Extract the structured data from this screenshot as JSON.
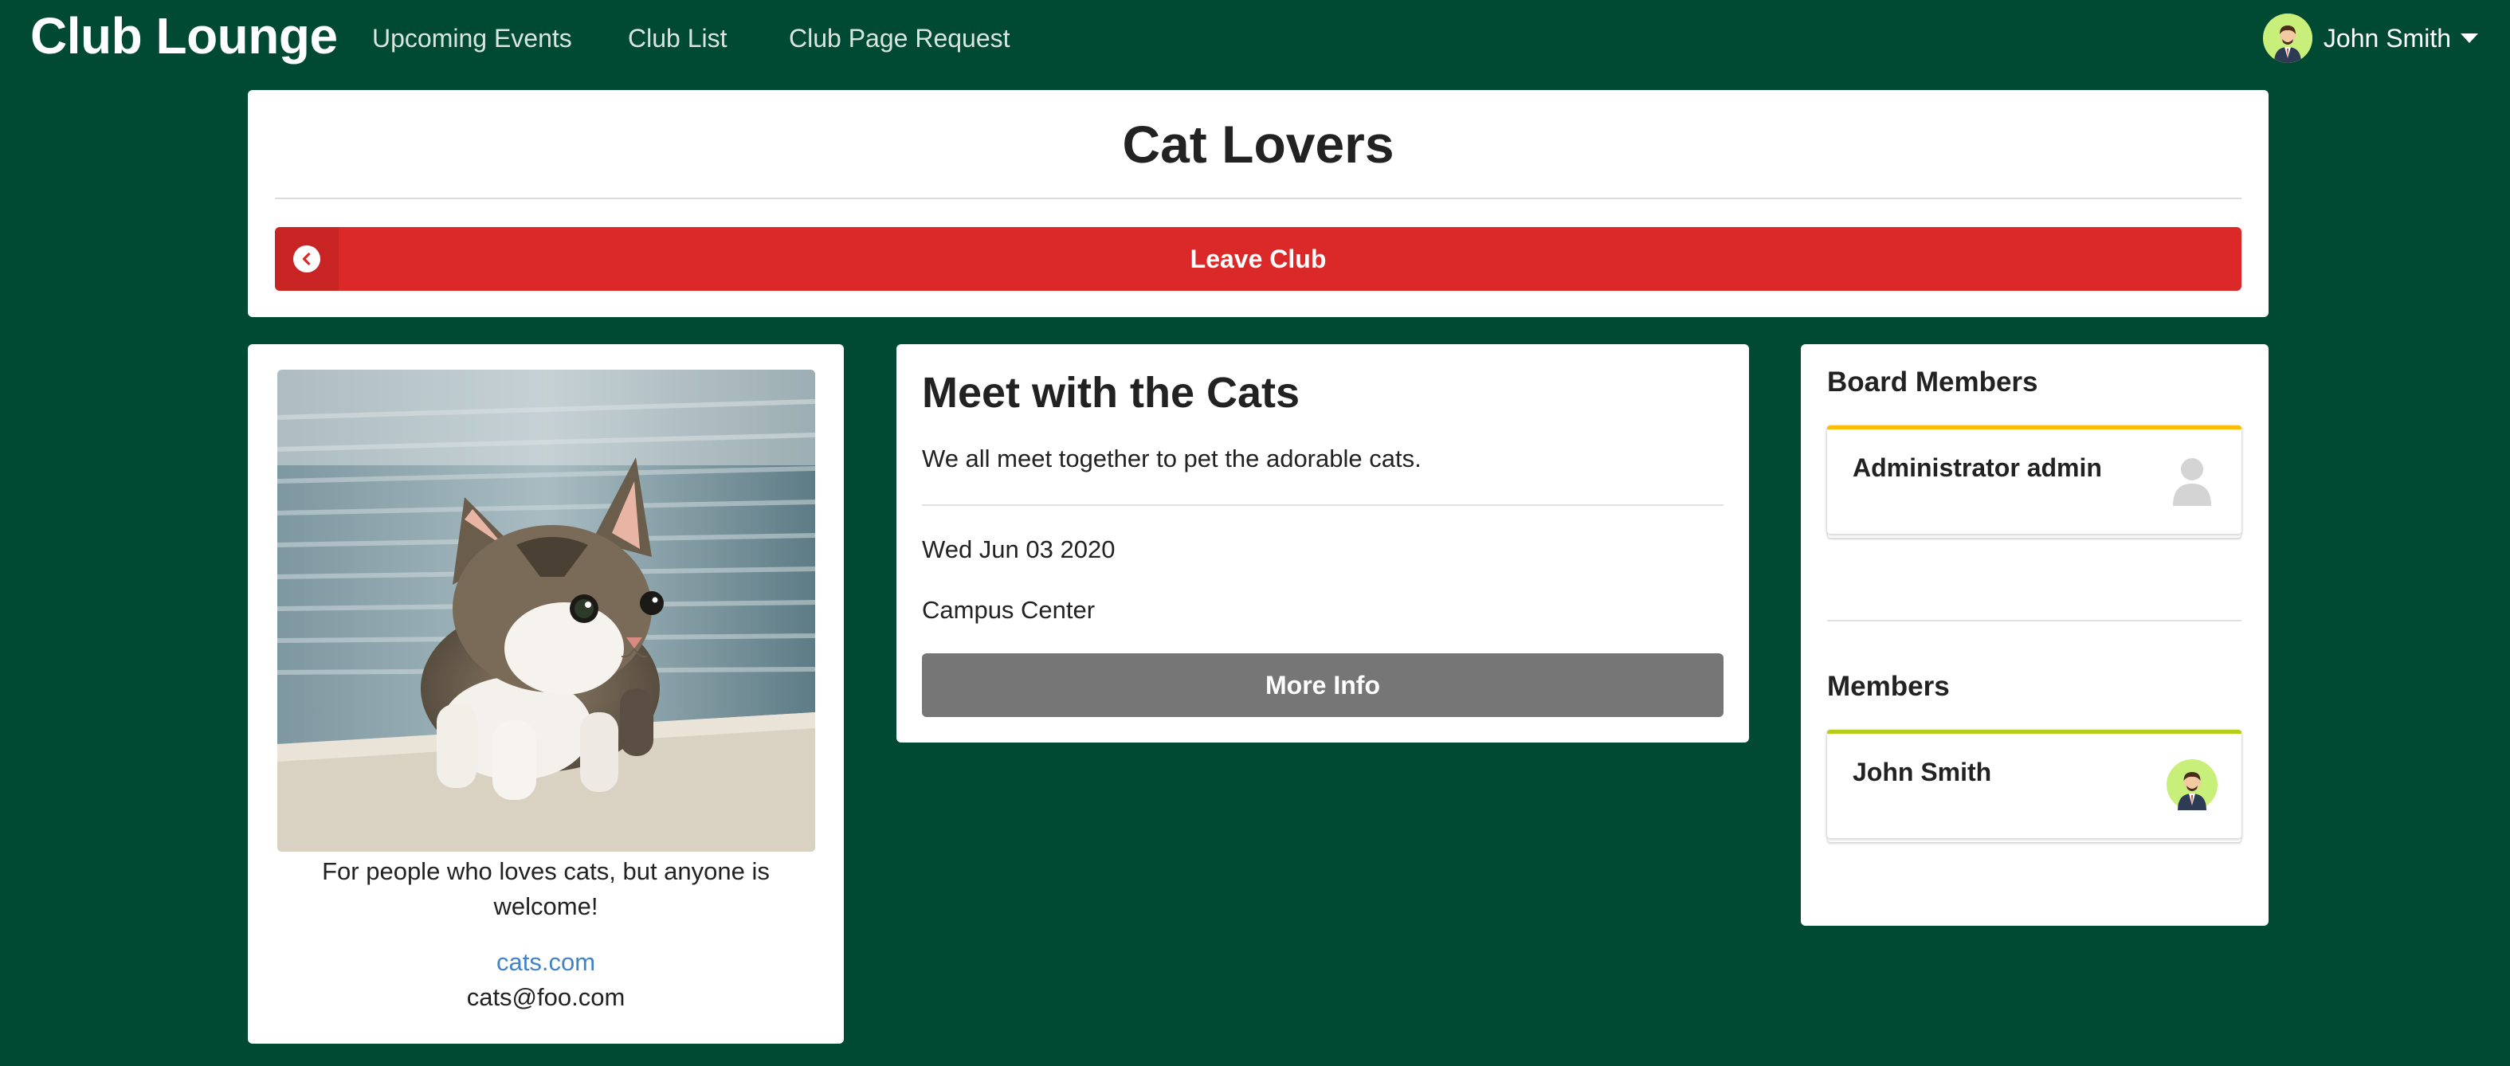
{
  "nav": {
    "brand": "Club Lounge",
    "links": [
      "Upcoming Events",
      "Club List",
      "Club Page Request"
    ],
    "user_name": "John Smith"
  },
  "club": {
    "title": "Cat Lovers",
    "leave_label": "Leave Club",
    "description": "For people who loves cats, but anyone is welcome!",
    "website": "cats.com",
    "email": "cats@foo.com"
  },
  "event": {
    "title": "Meet with the Cats",
    "description": "We all meet together to pet the adorable cats.",
    "date": "Wed Jun 03 2020",
    "location": "Campus Center",
    "more_label": "More Info"
  },
  "board": {
    "title": "Board Members",
    "members": [
      {
        "name": "Administrator admin",
        "icon": "user-placeholder-icon"
      }
    ]
  },
  "members": {
    "title": "Members",
    "members": [
      {
        "name": "John Smith",
        "icon": "avatar"
      }
    ]
  },
  "colors": {
    "background": "#004a33",
    "danger": "#db2828",
    "neutral": "#767676",
    "board_accent": "#fbbd08",
    "member_accent": "#b5cc18",
    "link": "#4183c4"
  }
}
